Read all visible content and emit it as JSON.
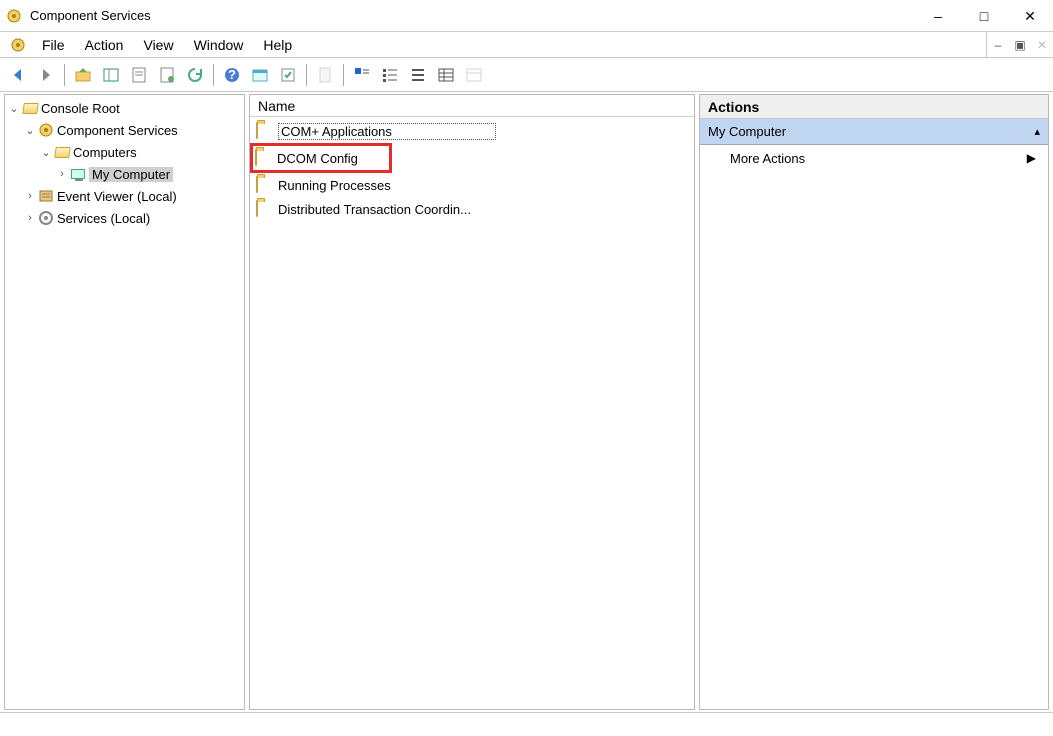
{
  "window": {
    "title": "Component Services"
  },
  "menu": {
    "items": [
      "File",
      "Action",
      "View",
      "Window",
      "Help"
    ]
  },
  "tree": [
    {
      "label": "Console Root",
      "indent": 0,
      "twisty": "v",
      "icon": "folder-open",
      "selected": false
    },
    {
      "label": "Component Services",
      "indent": 1,
      "twisty": "v",
      "icon": "gear",
      "selected": false
    },
    {
      "label": "Computers",
      "indent": 2,
      "twisty": "v",
      "icon": "folder-open",
      "selected": false
    },
    {
      "label": "My Computer",
      "indent": 3,
      "twisty": ">",
      "icon": "computer",
      "selected": true
    },
    {
      "label": "Event Viewer (Local)",
      "indent": 1,
      "twisty": ">",
      "icon": "event",
      "selected": false
    },
    {
      "label": "Services (Local)",
      "indent": 1,
      "twisty": ">",
      "icon": "services",
      "selected": false
    }
  ],
  "list": {
    "header": "Name",
    "items": [
      {
        "label": "COM+ Applications",
        "highlight": false,
        "selected": true
      },
      {
        "label": "DCOM Config",
        "highlight": true,
        "selected": false
      },
      {
        "label": "Running Processes",
        "highlight": false,
        "selected": false
      },
      {
        "label": "Distributed Transaction Coordin...",
        "highlight": false,
        "selected": false
      }
    ]
  },
  "actions": {
    "title": "Actions",
    "section": "My Computer",
    "more": "More Actions"
  }
}
